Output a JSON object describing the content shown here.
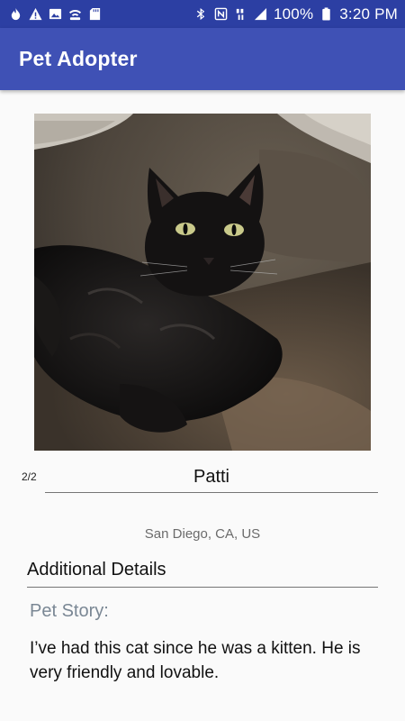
{
  "status_bar": {
    "left_icons": [
      "fire-icon",
      "warning-icon",
      "image-icon",
      "wifi-calling-icon",
      "sd-card-icon"
    ],
    "right_icons": [
      "bluetooth-icon",
      "nfc-icon",
      "network-type-icon",
      "signal-icon",
      "battery-icon"
    ],
    "battery": "100%",
    "time": "3:20 PM"
  },
  "app_bar": {
    "title": "Pet Adopter",
    "color": "#3f51b5"
  },
  "pet": {
    "photo_counter": "2/2",
    "name": "Patti",
    "location": "San Diego, CA, US",
    "details_header": "Additional Details",
    "story_label": "Pet Story:",
    "story": "I’ve had this cat since he was a kitten. He is very friendly and lovable."
  }
}
